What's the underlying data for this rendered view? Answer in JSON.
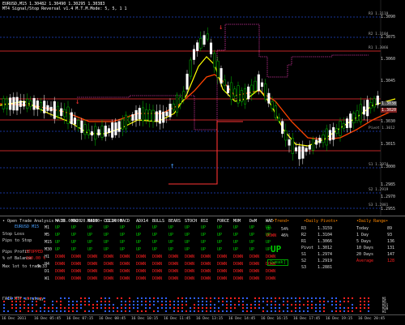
{
  "window": {
    "title": "EURUSD,M15  1.30482 1.30490 1.30295 1.30383",
    "indicator": "MT4 Signal/Stop Reversal v1.4 M.T.M.Mode: 5, 5, 1 1"
  },
  "price_axis": [
    "1.3090",
    "1.3075",
    "1.3060",
    "1.3045",
    "1.3030",
    "1.3015",
    "1.3000",
    "1.2985",
    "1.2970",
    "1.2955"
  ],
  "price_tags": {
    "current": "1.3038",
    "other": "1.3020"
  },
  "level_labels": [
    "R3 1.3119",
    "R2 1.3104",
    "R1 1.3066",
    "Pivot 1.3012",
    "S1 1.2974",
    "S2 1.2919",
    "S3 1.2881"
  ],
  "panel": {
    "title": "• Open Trade Analysis • 36.0000 20.0000 • 36.0000",
    "symbol": "EURUSD M15",
    "left_labels": [
      "Stop Loss",
      "Pips to Stop",
      "Pips Profit",
      "% of Balance",
      "Max lot to trade"
    ],
    "left_values": [
      "",
      "",
      "STOPPED",
      "100.00 %",
      "9.33"
    ],
    "columns": [
      "MA10",
      "MA20",
      "MA100",
      "CCI14",
      "MACD",
      "ADX14",
      "BULLS",
      "BEARS",
      "STOCH",
      "RSI",
      "FORCE",
      "MOM",
      "DeM",
      "WAE"
    ],
    "timeframes": [
      "M1",
      "M5",
      "M15",
      "M30",
      "H1",
      "H4",
      "D1",
      "W1"
    ],
    "rows": [
      [
        "UP",
        "UP",
        "UP",
        "UP",
        "UP",
        "UP",
        "UP",
        "UP",
        "UP",
        "UP",
        "UP",
        "UP",
        "UP",
        "UP"
      ],
      [
        "UP",
        "UP",
        "UP",
        "UP",
        "UP",
        "UP",
        "UP",
        "UP",
        "UP",
        "UP",
        "UP",
        "UP",
        "UP",
        "UP"
      ],
      [
        "UP",
        "UP",
        "UP",
        "UP",
        "UP",
        "UP",
        "UP",
        "UP",
        "UP",
        "UP",
        "UP",
        "UP",
        "UP",
        "UP"
      ],
      [
        "UP",
        "UP",
        "UP",
        "UP",
        "UP",
        "UP",
        "UP",
        "UP",
        "UP",
        "UP",
        "UP",
        "UP",
        "UP",
        "UP"
      ],
      [
        "DOWN",
        "DOWN",
        "DOWN",
        "DOWN",
        "DOWN",
        "DOWN",
        "DOWN",
        "DOWN",
        "DOWN",
        "DOWN",
        "DOWN",
        "DOWN",
        "DOWN",
        "DOWN"
      ],
      [
        "DOWN",
        "DOWN",
        "DOWN",
        "DOWN",
        "DOWN",
        "DOWN",
        "DOWN",
        "DOWN",
        "DOWN",
        "DOWN",
        "DOWN",
        "DOWN",
        "DOWN",
        "DOWN"
      ],
      [
        "DOWN",
        "DOWN",
        "DOWN",
        "DOWN",
        "DOWN",
        "DOWN",
        "DOWN",
        "DOWN",
        "DOWN",
        "DOWN",
        "DOWN",
        "DOWN",
        "DOWN",
        "DOWN"
      ],
      [
        "DOWN",
        "DOWN",
        "DOWN",
        "DOWN",
        "DOWN",
        "DOWN",
        "DOWN",
        "DOWN",
        "DOWN",
        "DOWN",
        "DOWN",
        "DOWN",
        "DOWN",
        "DOWN"
      ]
    ],
    "trend": {
      "header": "•Trend•",
      "up_label": "UP",
      "up_value": "54%",
      "down_label": "DOWN",
      "down_value": "46%",
      "signal": "UP",
      "strength": "[weak]"
    },
    "daily_pivots": {
      "header": "•Daily Pivots•",
      "labels": [
        "R3",
        "R2",
        "R1",
        "Pivot",
        "S1",
        "S2",
        "S3"
      ],
      "values": [
        "1.3159",
        "1.3104",
        "1.3066",
        "1.3012",
        "1.2974",
        "1.2919",
        "1.2881"
      ]
    },
    "daily_range": {
      "header": "•Daily Range•",
      "labels": [
        "Today",
        "1 Day",
        "5 Days",
        "10 Days",
        "20 Days",
        "Average"
      ],
      "values": [
        "89",
        "93",
        "136",
        "131",
        "147",
        "128"
      ]
    }
  },
  "bottom": {
    "title": "PAIR MTF strategy",
    "right_labels": [
      "M1",
      "M5",
      "M15",
      "M30",
      "H1"
    ]
  },
  "time_axis": [
    "16 Dec 2011",
    "16 Dec 05:45",
    "16 Dec 07:15",
    "16 Dec 08:45",
    "16 Dec 10:15",
    "16 Dec 11:45",
    "16 Dec 13:15",
    "16 Dec 14:45",
    "16 Dec 16:15",
    "16 Dec 17:45",
    "16 Dec 19:15",
    "16 Dec 20:45"
  ],
  "colors": {
    "bull": "#00c000",
    "bear": "#ffffff",
    "ma_fast": "#ffff00",
    "ma_mid": "#ff4400",
    "stop": "#cc3399",
    "pivot": "#ff3333",
    "level": "#2244cc"
  }
}
